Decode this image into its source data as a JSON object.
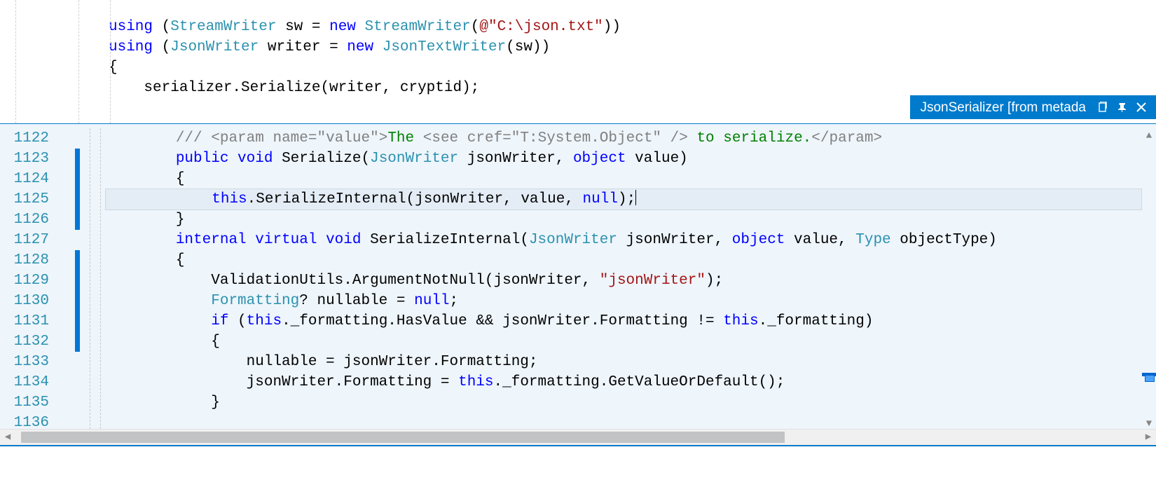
{
  "tab": {
    "title": "JsonSerializer [from metada"
  },
  "topEditor": {
    "lines": [
      {
        "tokens": [
          {
            "t": "using ",
            "c": "kw"
          },
          {
            "t": "(",
            "c": "plain"
          },
          {
            "t": "StreamWriter",
            "c": "type"
          },
          {
            "t": " sw = ",
            "c": "plain"
          },
          {
            "t": "new ",
            "c": "kw"
          },
          {
            "t": "StreamWriter",
            "c": "type"
          },
          {
            "t": "(",
            "c": "plain"
          },
          {
            "t": "@\"C:\\json.txt\"",
            "c": "str"
          },
          {
            "t": "))",
            "c": "plain"
          }
        ]
      },
      {
        "tokens": [
          {
            "t": "using ",
            "c": "kw"
          },
          {
            "t": "(",
            "c": "plain"
          },
          {
            "t": "JsonWriter",
            "c": "type"
          },
          {
            "t": " writer = ",
            "c": "plain"
          },
          {
            "t": "new ",
            "c": "kw"
          },
          {
            "t": "JsonTextWriter",
            "c": "type"
          },
          {
            "t": "(sw))",
            "c": "plain"
          }
        ]
      },
      {
        "tokens": [
          {
            "t": "{",
            "c": "plain"
          }
        ]
      },
      {
        "tokens": [
          {
            "t": "    serializer.Serialize(writer, cryptid);",
            "c": "plain"
          }
        ]
      }
    ]
  },
  "bottomEditor": {
    "startLine": 1122,
    "currentLine": 1125,
    "lines": [
      {
        "indent": 8,
        "tokens": [
          {
            "t": "/// ",
            "c": "comment"
          },
          {
            "t": "<param name=",
            "c": "comment"
          },
          {
            "t": "\"",
            "c": "comment"
          },
          {
            "t": "value",
            "c": "comment"
          },
          {
            "t": "\"",
            "c": "comment"
          },
          {
            "t": ">",
            "c": "comment"
          },
          {
            "t": "The ",
            "c": "com-xml"
          },
          {
            "t": "<see cref=",
            "c": "comment"
          },
          {
            "t": "\"",
            "c": "comment"
          },
          {
            "t": "T:System.Object",
            "c": "comment"
          },
          {
            "t": "\"",
            "c": "comment"
          },
          {
            "t": " />",
            "c": "comment"
          },
          {
            "t": " to serialize.",
            "c": "com-xml"
          },
          {
            "t": "</param>",
            "c": "comment"
          }
        ]
      },
      {
        "indent": 8,
        "tokens": [
          {
            "t": "public ",
            "c": "kw"
          },
          {
            "t": "void ",
            "c": "kw"
          },
          {
            "t": "Serialize(",
            "c": "plain"
          },
          {
            "t": "JsonWriter",
            "c": "type"
          },
          {
            "t": " jsonWriter, ",
            "c": "plain"
          },
          {
            "t": "object ",
            "c": "kw"
          },
          {
            "t": "value)",
            "c": "plain"
          }
        ]
      },
      {
        "indent": 8,
        "tokens": [
          {
            "t": "{",
            "c": "plain"
          }
        ]
      },
      {
        "indent": 12,
        "tokens": [
          {
            "t": "this",
            "c": "kw"
          },
          {
            "t": ".SerializeInternal(jsonWriter, value, ",
            "c": "plain"
          },
          {
            "t": "null",
            "c": "kw"
          },
          {
            "t": ");",
            "c": "plain"
          }
        ],
        "current": true
      },
      {
        "indent": 8,
        "tokens": [
          {
            "t": "}",
            "c": "plain"
          }
        ]
      },
      {
        "indent": 0,
        "tokens": [
          {
            "t": "",
            "c": "plain"
          }
        ]
      },
      {
        "indent": 8,
        "tokens": [
          {
            "t": "internal ",
            "c": "kw"
          },
          {
            "t": "virtual ",
            "c": "kw"
          },
          {
            "t": "void ",
            "c": "kw"
          },
          {
            "t": "SerializeInternal(",
            "c": "plain"
          },
          {
            "t": "JsonWriter",
            "c": "type"
          },
          {
            "t": " jsonWriter, ",
            "c": "plain"
          },
          {
            "t": "object ",
            "c": "kw"
          },
          {
            "t": "value, ",
            "c": "plain"
          },
          {
            "t": "Type",
            "c": "type"
          },
          {
            "t": " objectType)",
            "c": "plain"
          }
        ]
      },
      {
        "indent": 8,
        "tokens": [
          {
            "t": "{",
            "c": "plain"
          }
        ]
      },
      {
        "indent": 12,
        "tokens": [
          {
            "t": "ValidationUtils.ArgumentNotNull(jsonWriter, ",
            "c": "plain"
          },
          {
            "t": "\"jsonWriter\"",
            "c": "str"
          },
          {
            "t": ");",
            "c": "plain"
          }
        ]
      },
      {
        "indent": 12,
        "tokens": [
          {
            "t": "Formatting",
            "c": "type"
          },
          {
            "t": "? nullable = ",
            "c": "plain"
          },
          {
            "t": "null",
            "c": "kw"
          },
          {
            "t": ";",
            "c": "plain"
          }
        ]
      },
      {
        "indent": 12,
        "tokens": [
          {
            "t": "if ",
            "c": "kw"
          },
          {
            "t": "(",
            "c": "plain"
          },
          {
            "t": "this",
            "c": "kw"
          },
          {
            "t": "._formatting.HasValue && jsonWriter.Formatting != ",
            "c": "plain"
          },
          {
            "t": "this",
            "c": "kw"
          },
          {
            "t": "._formatting)",
            "c": "plain"
          }
        ]
      },
      {
        "indent": 12,
        "tokens": [
          {
            "t": "{",
            "c": "plain"
          }
        ]
      },
      {
        "indent": 16,
        "tokens": [
          {
            "t": "nullable = jsonWriter.Formatting;",
            "c": "plain"
          }
        ]
      },
      {
        "indent": 16,
        "tokens": [
          {
            "t": "jsonWriter.Formatting = ",
            "c": "plain"
          },
          {
            "t": "this",
            "c": "kw"
          },
          {
            "t": "._formatting.GetValueOrDefault();",
            "c": "plain"
          }
        ]
      },
      {
        "indent": 12,
        "tokens": [
          {
            "t": "}",
            "c": "plain"
          }
        ]
      }
    ]
  }
}
